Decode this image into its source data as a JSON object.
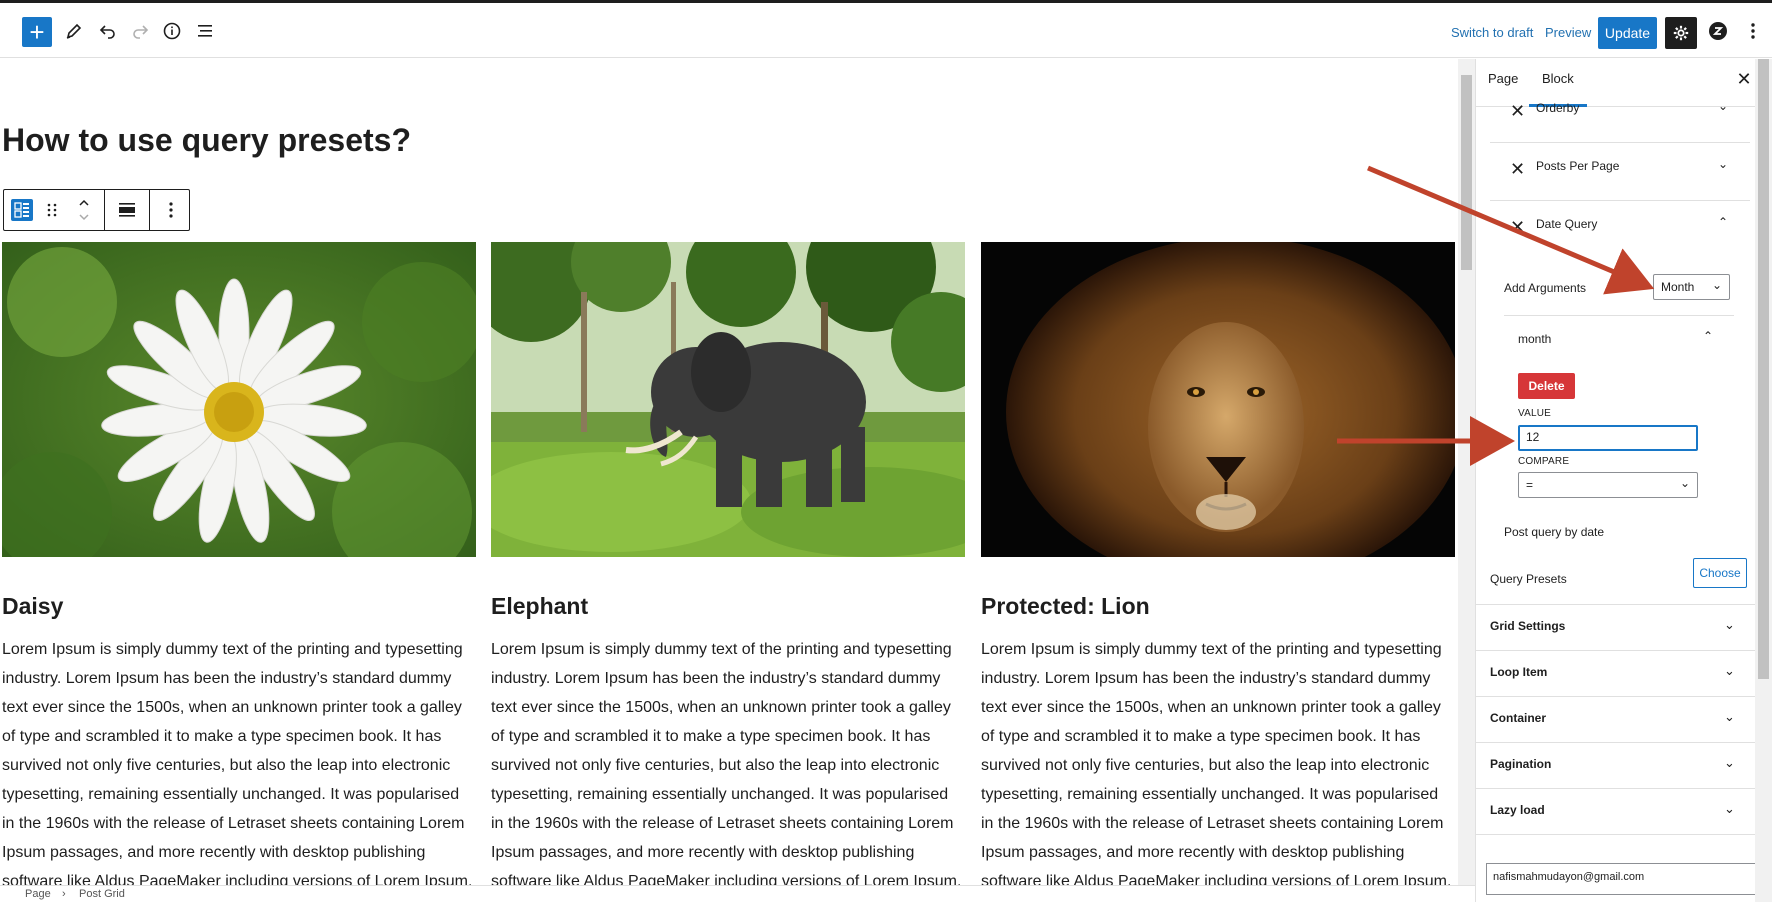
{
  "header": {
    "inserter_label": "+",
    "switch_to_draft": "Switch to draft",
    "preview": "Preview",
    "update": "Update"
  },
  "content": {
    "title": "How to use query presets?",
    "cards": [
      {
        "title": "Daisy",
        "text": "Lorem Ipsum is simply dummy text of the printing and typesetting industry. Lorem Ipsum has been the industry’s standard dummy text ever since the 1500s, when an unknown printer took a galley of type and scrambled it to make a type specimen book. It has survived not only five centuries, but also the leap into electronic typesetting, remaining essentially unchanged. It was popularised in the 1960s with the release of Letraset sheets containing Lorem Ipsum passages, and more recently with desktop publishing software like Aldus PageMaker including versions of Lorem Ipsum."
      },
      {
        "title": "Elephant",
        "text": "Lorem Ipsum is simply dummy text of the printing and typesetting industry. Lorem Ipsum has been the industry’s standard dummy text ever since the 1500s, when an unknown printer took a galley of type and scrambled it to make a type specimen book. It has survived not only five centuries, but also the leap into electronic typesetting, remaining essentially unchanged. It was popularised in the 1960s with the release of Letraset sheets containing Lorem Ipsum passages, and more recently with desktop publishing software like Aldus PageMaker including versions of Lorem Ipsum."
      },
      {
        "title": "Protected: Lion",
        "text": "Lorem Ipsum is simply dummy text of the printing and typesetting industry. Lorem Ipsum has been the industry’s standard dummy text ever since the 1500s, when an unknown printer took a galley of type and scrambled it to make a type specimen book. It has survived not only five centuries, but also the leap into electronic typesetting, remaining essentially unchanged. It was popularised in the 1960s with the release of Letraset sheets containing Lorem Ipsum passages, and more recently with desktop publishing software like Aldus PageMaker including versions of Lorem Ipsum."
      }
    ]
  },
  "breadcrumb": [
    "Page",
    "Post Grid"
  ],
  "sidebar": {
    "tabs": [
      "Page",
      "Block"
    ],
    "active_tab": "Block",
    "query_items": [
      "Orderby",
      "Posts Per Page",
      "Date Query"
    ],
    "add_arguments_label": "Add Arguments",
    "add_arguments_value": "Month",
    "argument_title": "month",
    "delete_label": "Delete",
    "value_label": "VALUE",
    "value": "12",
    "compare_label": "COMPARE",
    "compare_value": "=",
    "post_query_by_date": "Post query by date",
    "query_presets_label": "Query Presets",
    "choose_label": "Choose",
    "panels": [
      "Grid Settings",
      "Loop Item",
      "Container",
      "Pagination",
      "Lazy load"
    ],
    "email": "nafismahmudayon@gmail.com"
  },
  "colors": {
    "accent": "#1877c7",
    "delete": "#d63638",
    "annotation_arrow": "#c0432c"
  }
}
